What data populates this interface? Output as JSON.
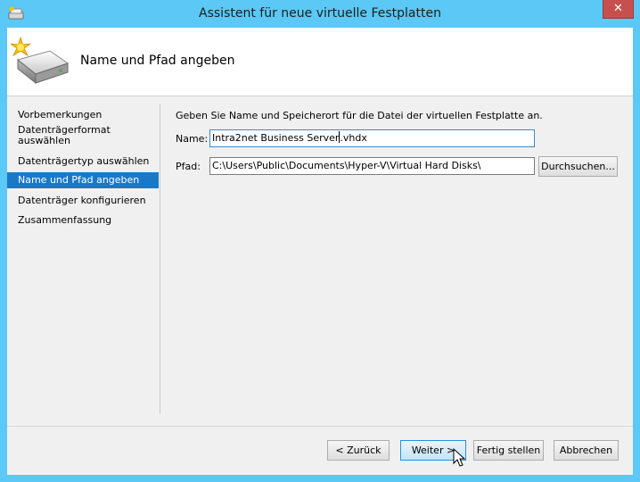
{
  "window": {
    "title": "Assistent für neue virtuelle Festplatten",
    "close_label": "✕"
  },
  "header": {
    "title": "Name und Pfad angeben"
  },
  "nav": {
    "items": [
      {
        "label": "Vorbemerkungen"
      },
      {
        "label": "Datenträgerformat auswählen"
      },
      {
        "label": "Datenträgertyp auswählen"
      },
      {
        "label": "Name und Pfad angeben",
        "selected": true
      },
      {
        "label": "Datenträger konfigurieren"
      },
      {
        "label": "Zusammenfassung"
      }
    ]
  },
  "main": {
    "description": "Geben Sie Name und Speicherort für die Datei der virtuellen Festplatte an.",
    "name_label": "Name:",
    "name_value_before_caret": "Intra2net Business Server",
    "name_value_after_caret": ".vhdx",
    "path_label": "Pfad:",
    "path_value": "C:\\Users\\Public\\Documents\\Hyper-V\\Virtual Hard Disks\\",
    "browse_label": "Durchsuchen..."
  },
  "footer": {
    "back_label": "< Zurück",
    "next_label": "Weiter >",
    "finish_label": "Fertig stellen",
    "cancel_label": "Abbrechen"
  },
  "colors": {
    "frame": "#5bc8f5",
    "selected": "#1a79c7",
    "close": "#c7504f"
  }
}
